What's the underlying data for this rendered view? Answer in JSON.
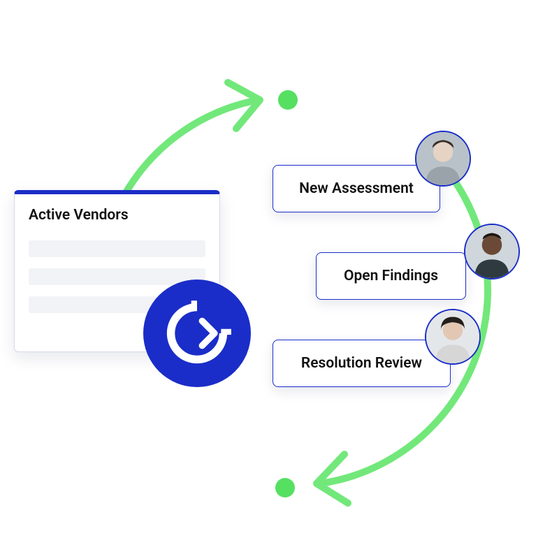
{
  "colors": {
    "accent_blue": "#1a2dc8",
    "cycle_green": "#72e87a",
    "dot_green": "#55e061"
  },
  "vendors": {
    "title": "Active Vendors"
  },
  "steps": {
    "s1": "New Assessment",
    "s2": "Open Findings",
    "s3": "Resolution Review"
  },
  "avatars": {
    "a1": "avatar-person-1",
    "a2": "avatar-person-2",
    "a3": "avatar-person-3"
  },
  "logo": {
    "name": "circular-arrow-logo"
  }
}
